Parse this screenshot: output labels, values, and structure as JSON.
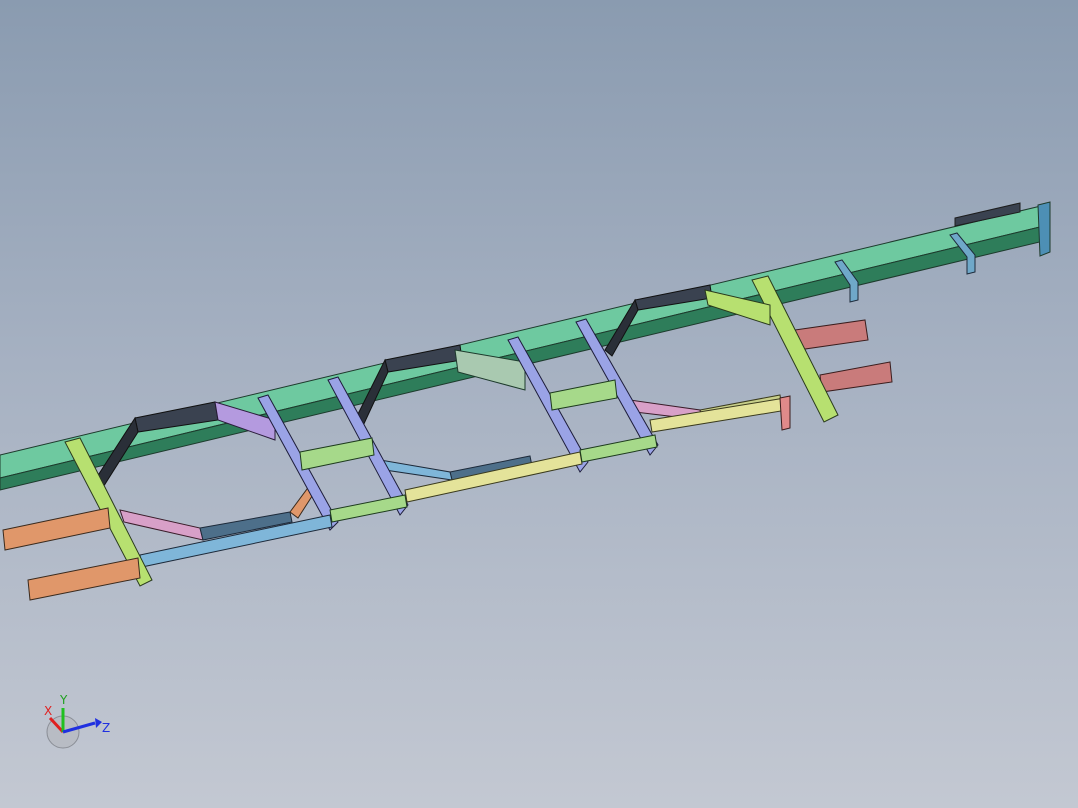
{
  "viewport": {
    "background_top": "#8a9bb0",
    "background_bottom": "#c3c8d2"
  },
  "model": {
    "colors": {
      "main_rail": "#6ec9a0",
      "main_rail_side": "#2e7d5a",
      "lower_rail_blue": "#7fb6d9",
      "lower_rail_yellow": "#e4e39a",
      "lower_rail_green": "#a6d98a",
      "cross_member_violet": "#9aa3e6",
      "diagonal_lime": "#b7e070",
      "outrigger_orange": "#e0976a",
      "outrigger_red": "#c97b7b",
      "bracket_steel": "#6fa8c9",
      "dark_panel": "#3a4250"
    }
  },
  "triad": {
    "x_label": "X",
    "y_label": "Y",
    "z_label": "Z",
    "x_color": "#e02020",
    "y_color": "#20c020",
    "z_color": "#2030e0"
  }
}
